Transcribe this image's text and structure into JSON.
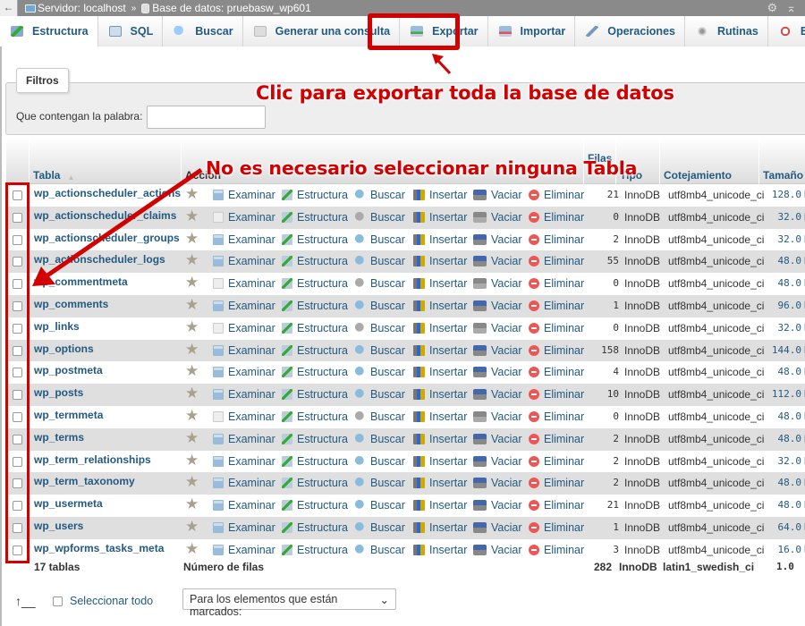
{
  "topbar": {
    "back_icon": "arrow-left-icon",
    "server_label": "Servidor: localhost",
    "separator": "»",
    "database_label": "Base de datos: pruebasw_wp601",
    "settings_icon": "gear-icon",
    "collapse_icon": "collapse-up-icon"
  },
  "tabs": [
    {
      "label": "Estructura",
      "icon": "structure-icon",
      "active": true
    },
    {
      "label": "SQL",
      "icon": "sql-icon"
    },
    {
      "label": "Buscar",
      "icon": "search-icon"
    },
    {
      "label": "Generar una consulta",
      "icon": "query-icon"
    },
    {
      "label": "Exportar",
      "icon": "export-icon"
    },
    {
      "label": "Importar",
      "icon": "import-icon"
    },
    {
      "label": "Operaciones",
      "icon": "wrench-icon"
    },
    {
      "label": "Rutinas",
      "icon": "routines-icon"
    },
    {
      "label": "Eventos",
      "icon": "clock-icon"
    }
  ],
  "annotations": {
    "export_hint": "Clic para exportar toda la base de datos",
    "tables_hint": "No es necesario seleccionar ninguna Tabla",
    "color": "#d20000"
  },
  "filters": {
    "legend": "Filtros",
    "label": "Que contengan la palabra:",
    "value": ""
  },
  "table": {
    "headers": {
      "name": "Tabla",
      "action": "Acción",
      "rows": "Filas",
      "type": "Tipo",
      "collation": "Cotejamiento",
      "size": "Tamaño"
    },
    "actions": [
      "Examinar",
      "Estructura",
      "Buscar",
      "Insertar",
      "Vaciar",
      "Eliminar"
    ],
    "rows": [
      {
        "name": "wp_actionscheduler_actions",
        "rows": "21",
        "type": "InnoDB",
        "collation": "utf8mb4_unicode_ci",
        "size": "128.0",
        "empty": false
      },
      {
        "name": "wp_actionscheduler_claims",
        "rows": "0",
        "type": "InnoDB",
        "collation": "utf8mb4_unicode_ci",
        "size": "32.0",
        "empty": true
      },
      {
        "name": "wp_actionscheduler_groups",
        "rows": "2",
        "type": "InnoDB",
        "collation": "utf8mb4_unicode_ci",
        "size": "32.0",
        "empty": false
      },
      {
        "name": "wp_actionscheduler_logs",
        "rows": "55",
        "type": "InnoDB",
        "collation": "utf8mb4_unicode_ci",
        "size": "48.0",
        "empty": false
      },
      {
        "name": "wp_commentmeta",
        "rows": "0",
        "type": "InnoDB",
        "collation": "utf8mb4_unicode_ci",
        "size": "48.0",
        "empty": true
      },
      {
        "name": "wp_comments",
        "rows": "1",
        "type": "InnoDB",
        "collation": "utf8mb4_unicode_ci",
        "size": "96.0",
        "empty": false
      },
      {
        "name": "wp_links",
        "rows": "0",
        "type": "InnoDB",
        "collation": "utf8mb4_unicode_ci",
        "size": "32.0",
        "empty": true
      },
      {
        "name": "wp_options",
        "rows": "158",
        "type": "InnoDB",
        "collation": "utf8mb4_unicode_ci",
        "size": "144.0",
        "empty": false
      },
      {
        "name": "wp_postmeta",
        "rows": "4",
        "type": "InnoDB",
        "collation": "utf8mb4_unicode_ci",
        "size": "48.0",
        "empty": false
      },
      {
        "name": "wp_posts",
        "rows": "10",
        "type": "InnoDB",
        "collation": "utf8mb4_unicode_ci",
        "size": "112.0",
        "empty": false
      },
      {
        "name": "wp_termmeta",
        "rows": "0",
        "type": "InnoDB",
        "collation": "utf8mb4_unicode_ci",
        "size": "48.0",
        "empty": true
      },
      {
        "name": "wp_terms",
        "rows": "2",
        "type": "InnoDB",
        "collation": "utf8mb4_unicode_ci",
        "size": "48.0",
        "empty": false
      },
      {
        "name": "wp_term_relationships",
        "rows": "2",
        "type": "InnoDB",
        "collation": "utf8mb4_unicode_ci",
        "size": "32.0",
        "empty": false
      },
      {
        "name": "wp_term_taxonomy",
        "rows": "2",
        "type": "InnoDB",
        "collation": "utf8mb4_unicode_ci",
        "size": "48.0",
        "empty": false
      },
      {
        "name": "wp_usermeta",
        "rows": "21",
        "type": "InnoDB",
        "collation": "utf8mb4_unicode_ci",
        "size": "48.0",
        "empty": false
      },
      {
        "name": "wp_users",
        "rows": "1",
        "type": "InnoDB",
        "collation": "utf8mb4_unicode_ci",
        "size": "64.0",
        "empty": false
      },
      {
        "name": "wp_wpforms_tasks_meta",
        "rows": "3",
        "type": "InnoDB",
        "collation": "utf8mb4_unicode_ci",
        "size": "16.0",
        "empty": false
      }
    ],
    "size_unit": "KiB",
    "footer": {
      "count": "17 tablas",
      "rows_label": "Número de filas",
      "rows_total": "282",
      "type": "InnoDB",
      "collation": "latin1_swedish_ci",
      "size": "1.0"
    }
  },
  "bottom": {
    "select_all": "Seleccionar todo",
    "bulk_action": "Para los elementos que están marcados:"
  }
}
